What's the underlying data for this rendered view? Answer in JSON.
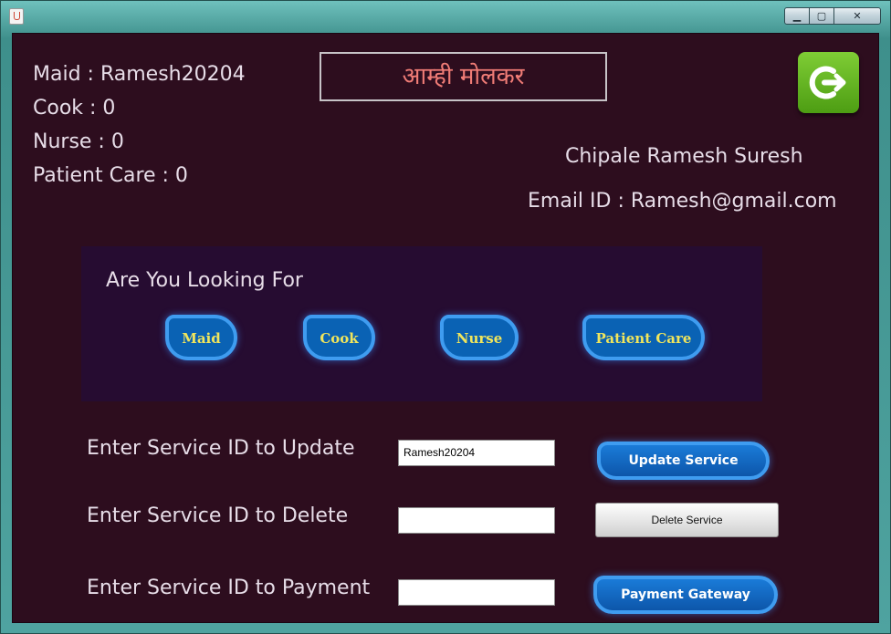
{
  "window": {
    "controls": {
      "minimize": "▁",
      "maximize": "▢",
      "close": "✕"
    }
  },
  "summary": {
    "maid": "Maid : Ramesh20204",
    "cook": "Cook : 0",
    "nurse": "Nurse : 0",
    "patient_care": "Patient Care : 0"
  },
  "app_title": "आम्ही मोलकर",
  "user": {
    "name": "Chipale Ramesh Suresh",
    "email": "Email ID : Ramesh@gmail.com"
  },
  "search_panel": {
    "heading": "Are You Looking For",
    "options": [
      "Maid",
      "Cook",
      "Nurse",
      "Patient Care"
    ]
  },
  "actions": {
    "update_label": "Enter Service ID to Update",
    "update_value": "Ramesh20204",
    "update_button": "Update Service",
    "delete_label": "Enter Service ID to Delete",
    "delete_value": "",
    "delete_button": "Delete Service",
    "payment_label": "Enter Service ID to Payment",
    "payment_value": "",
    "payment_button": "Payment Gateway"
  },
  "colors": {
    "background": "#2d0d1e",
    "panel": "#260c31",
    "accent_blue": "#0a62b4",
    "pill_text": "#f0e55c",
    "title_text": "#f07c76"
  }
}
